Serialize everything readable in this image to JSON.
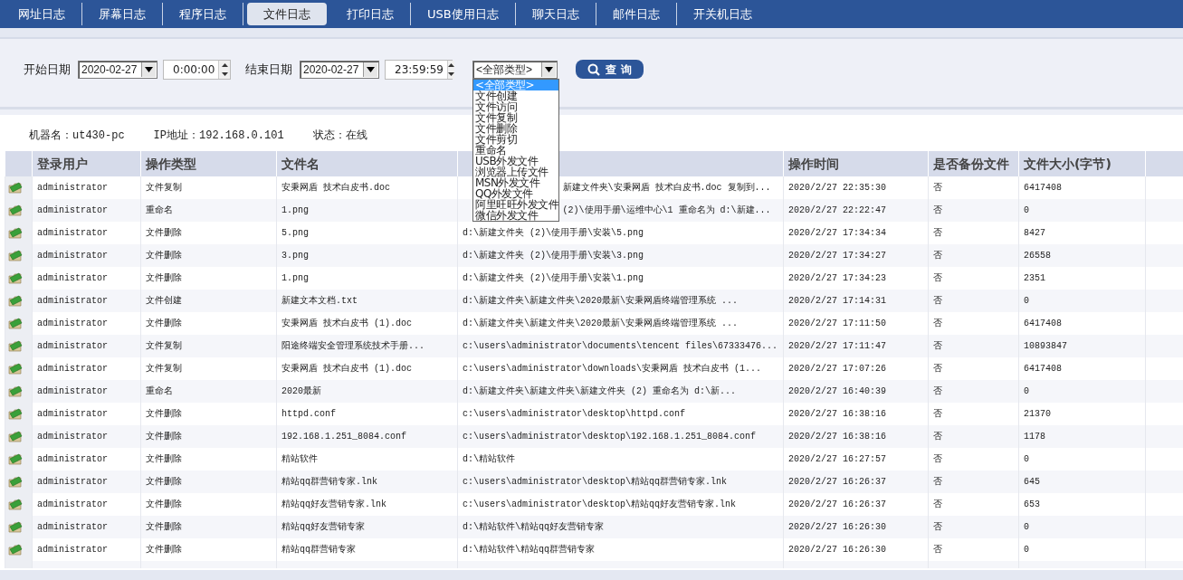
{
  "tabs": [
    {
      "label": "网址日志",
      "selected": false
    },
    {
      "label": "屏幕日志",
      "selected": false
    },
    {
      "label": "程序日志",
      "selected": false
    },
    {
      "label": "文件日志",
      "selected": true
    },
    {
      "label": "打印日志",
      "selected": false
    },
    {
      "label": "USB使用日志",
      "selected": false
    },
    {
      "label": "聊天日志",
      "selected": false
    },
    {
      "label": "邮件日志",
      "selected": false
    },
    {
      "label": "开关机日志",
      "selected": false
    }
  ],
  "filters": {
    "start_label": "开始日期",
    "start_date": "2020-02-27",
    "start_time": "0:00:00",
    "end_label": "结束日期",
    "end_date": "2020-02-27",
    "end_time": "23:59:59",
    "type_select": {
      "value": "<全部类型>",
      "expanded": true,
      "options": [
        {
          "label": "<全部类型>",
          "selected": true
        },
        {
          "label": "文件创建",
          "selected": false
        },
        {
          "label": "文件访问",
          "selected": false
        },
        {
          "label": "文件复制",
          "selected": false
        },
        {
          "label": "文件删除",
          "selected": false
        },
        {
          "label": "文件剪切",
          "selected": false
        },
        {
          "label": "重命名",
          "selected": false
        },
        {
          "label": "USB外发文件",
          "selected": false
        },
        {
          "label": "浏览器上传文件",
          "selected": false
        },
        {
          "label": "MSN外发文件",
          "selected": false
        },
        {
          "label": "QQ外发文件",
          "selected": false
        },
        {
          "label": "阿里旺旺外发文件",
          "selected": false
        },
        {
          "label": "微信外发文件",
          "selected": false
        }
      ]
    },
    "search_button": "查 询"
  },
  "info": {
    "machine": "机器名：ut430-pc",
    "ip": "IP地址：192.168.0.101",
    "status": "状态：在线"
  },
  "table": {
    "columns": [
      {
        "label": "登录用户"
      },
      {
        "label": "操作类型"
      },
      {
        "label": "文件名"
      },
      {
        "covered": true
      },
      {
        "label": "操作时间"
      },
      {
        "label": "是否备份文件"
      },
      {
        "label": "文件大小(字节)"
      }
    ],
    "rows": [
      {
        "user": "administrator",
        "operation": "文件复制",
        "file_name": "安秉网盾 技术白皮书.doc",
        "column_4": "新建文件夹\\安秉网盾 技术白皮书.doc 复制到...",
        "column_4_covered": true,
        "time": "2020/2/27 22:35:30",
        "backup": "否",
        "size": "6417408"
      },
      {
        "user": "administrator",
        "operation": "重命名",
        "file_name": "1.png",
        "column_4": "(2)\\使用手册\\运维中心\\1 重命名为 d:\\新建...",
        "column_4_covered": true,
        "time": "2020/2/27 22:22:47",
        "backup": "否",
        "size": "0"
      },
      {
        "user": "administrator",
        "operation": "文件删除",
        "file_name": "5.png",
        "column_4": "d:\\新建文件夹 (2)\\使用手册\\安装\\5.png",
        "time": "2020/2/27 17:34:34",
        "backup": "否",
        "size": "8427"
      },
      {
        "user": "administrator",
        "operation": "文件删除",
        "file_name": "3.png",
        "column_4": "d:\\新建文件夹 (2)\\使用手册\\安装\\3.png",
        "time": "2020/2/27 17:34:27",
        "backup": "否",
        "size": "26558"
      },
      {
        "user": "administrator",
        "operation": "文件删除",
        "file_name": "1.png",
        "column_4": "d:\\新建文件夹 (2)\\使用手册\\安装\\1.png",
        "time": "2020/2/27 17:34:23",
        "backup": "否",
        "size": "2351"
      },
      {
        "user": "administrator",
        "operation": "文件创建",
        "file_name": "新建文本文档.txt",
        "column_4": "d:\\新建文件夹\\新建文件夹\\2020最新\\安秉网盾终端管理系统 ...",
        "time": "2020/2/27 17:14:31",
        "backup": "否",
        "size": "0"
      },
      {
        "user": "administrator",
        "operation": "文件删除",
        "file_name": "安秉网盾 技术白皮书 (1).doc",
        "column_4": "d:\\新建文件夹\\新建文件夹\\2020最新\\安秉网盾终端管理系统 ...",
        "time": "2020/2/27 17:11:50",
        "backup": "否",
        "size": "6417408"
      },
      {
        "user": "administrator",
        "operation": "文件复制",
        "file_name": "阳途终端安全管理系统技术手册...",
        "column_4": "c:\\users\\administrator\\documents\\tencent files\\67333476...",
        "time": "2020/2/27 17:11:47",
        "backup": "否",
        "size": "10893847"
      },
      {
        "user": "administrator",
        "operation": "文件复制",
        "file_name": "安秉网盾 技术白皮书 (1).doc",
        "column_4": "c:\\users\\administrator\\downloads\\安秉网盾 技术白皮书 (1...",
        "time": "2020/2/27 17:07:26",
        "backup": "否",
        "size": "6417408"
      },
      {
        "user": "administrator",
        "operation": "重命名",
        "file_name": "2020最新",
        "column_4": "d:\\新建文件夹\\新建文件夹\\新建文件夹 (2) 重命名为 d:\\新...",
        "time": "2020/2/27 16:40:39",
        "backup": "否",
        "size": "0"
      },
      {
        "user": "administrator",
        "operation": "文件删除",
        "file_name": "httpd.conf",
        "column_4": "c:\\users\\administrator\\desktop\\httpd.conf",
        "time": "2020/2/27 16:38:16",
        "backup": "否",
        "size": "21370"
      },
      {
        "user": "administrator",
        "operation": "文件删除",
        "file_name": "192.168.1.251_8084.conf",
        "column_4": "c:\\users\\administrator\\desktop\\192.168.1.251_8084.conf",
        "time": "2020/2/27 16:38:16",
        "backup": "否",
        "size": "1178"
      },
      {
        "user": "administrator",
        "operation": "文件删除",
        "file_name": "精站软件",
        "column_4": "d:\\精站软件",
        "time": "2020/2/27 16:27:57",
        "backup": "否",
        "size": "0"
      },
      {
        "user": "administrator",
        "operation": "文件删除",
        "file_name": "精站qq群营销专家.lnk",
        "column_4": "c:\\users\\administrator\\desktop\\精站qq群营销专家.lnk",
        "time": "2020/2/27 16:26:37",
        "backup": "否",
        "size": "645"
      },
      {
        "user": "administrator",
        "operation": "文件删除",
        "file_name": "精站qq好友营销专家.lnk",
        "column_4": "c:\\users\\administrator\\desktop\\精站qq好友营销专家.lnk",
        "time": "2020/2/27 16:26:37",
        "backup": "否",
        "size": "653"
      },
      {
        "user": "administrator",
        "operation": "文件删除",
        "file_name": "精站qq好友营销专家",
        "column_4": "d:\\精站软件\\精站qq好友营销专家",
        "time": "2020/2/27 16:26:30",
        "backup": "否",
        "size": "0"
      },
      {
        "user": "administrator",
        "operation": "文件删除",
        "file_name": "精站qq群营销专家",
        "column_4": "d:\\精站软件\\精站qq群营销专家",
        "time": "2020/2/27 16:26:30",
        "backup": "否",
        "size": "0"
      }
    ]
  }
}
